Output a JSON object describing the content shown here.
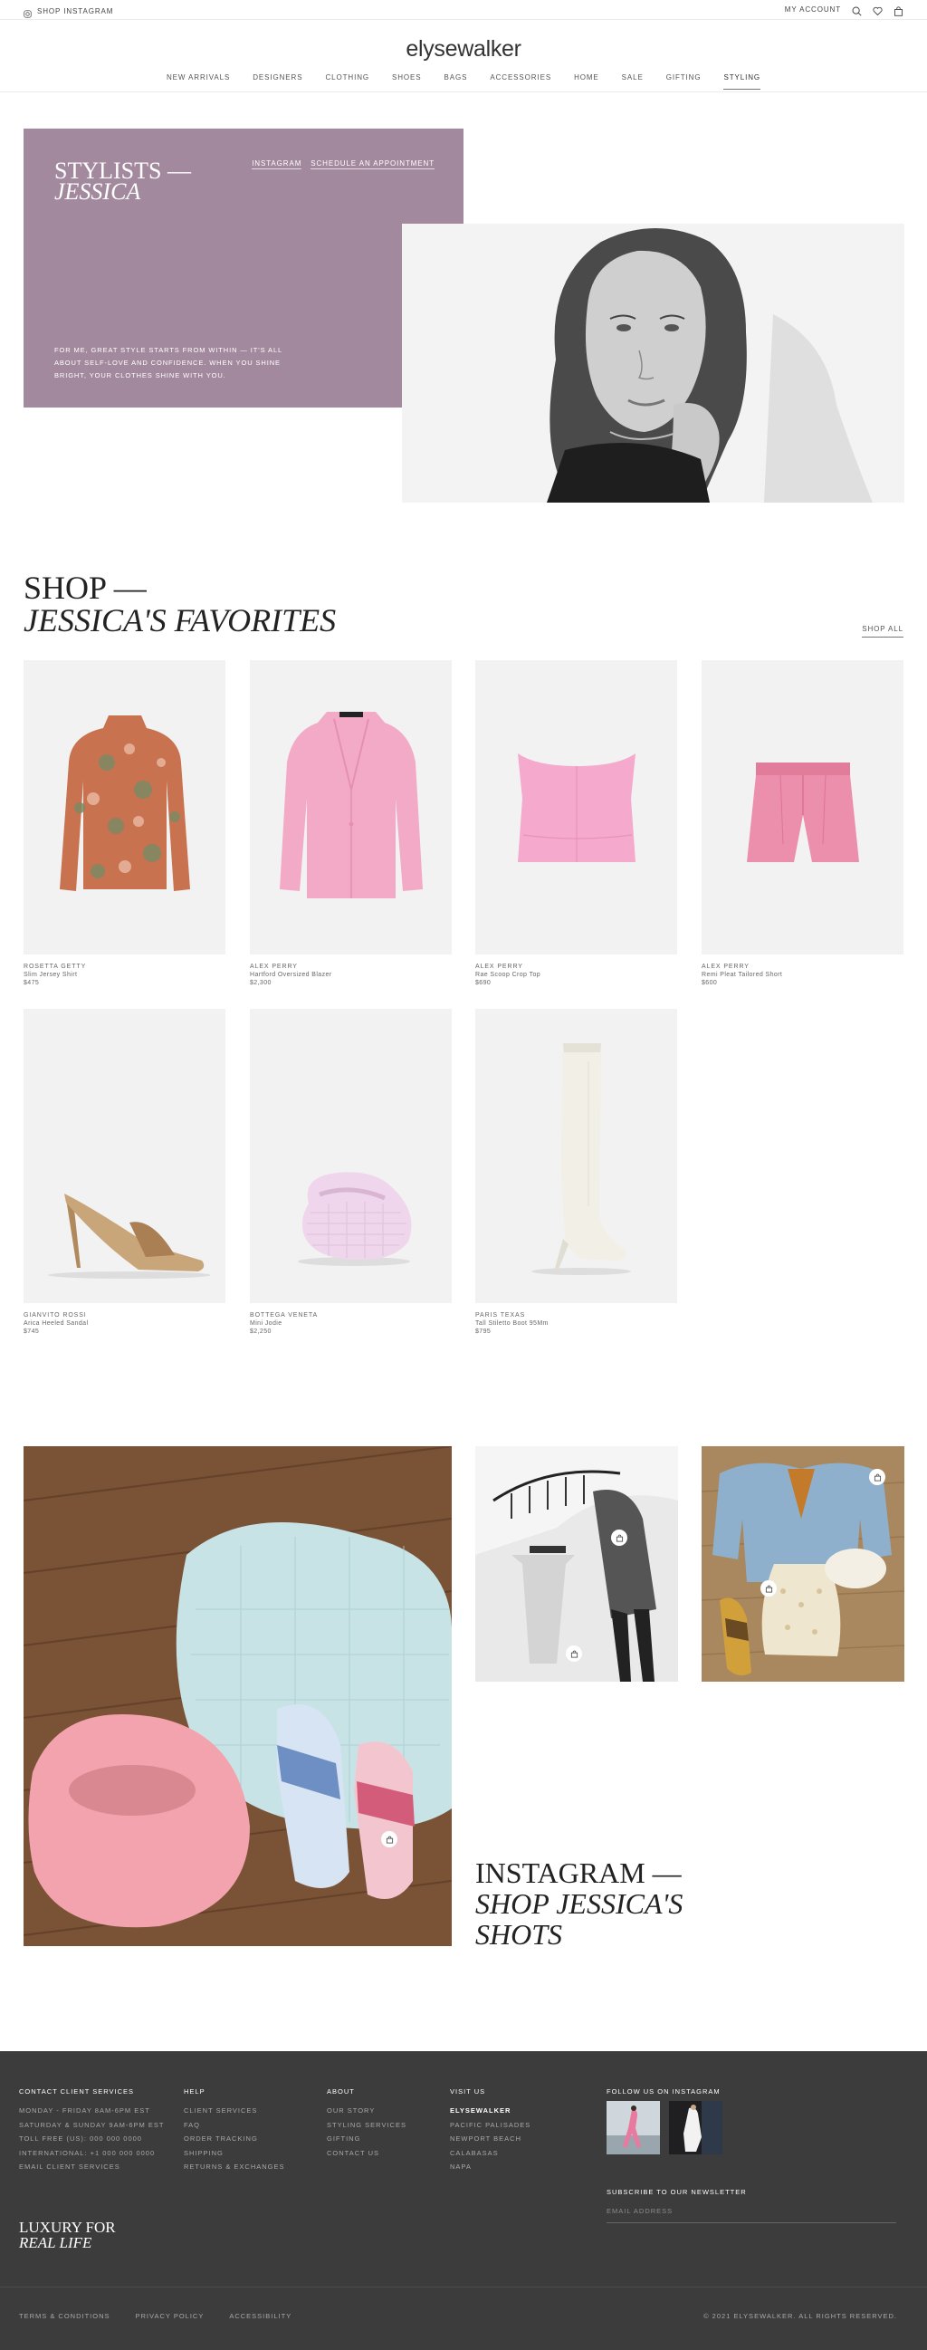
{
  "topbar": {
    "shop_instagram": "SHOP INSTAGRAM",
    "my_account": "MY ACCOUNT"
  },
  "header": {
    "logo": "elysewalker",
    "nav": [
      "NEW ARRIVALS",
      "DESIGNERS",
      "CLOTHING",
      "SHOES",
      "BAGS",
      "ACCESSORIES",
      "HOME",
      "SALE",
      "GIFTING",
      "STYLING"
    ],
    "active_nav": "STYLING"
  },
  "hero": {
    "title_line1": "STYLISTS —",
    "title_line2": "JESSICA",
    "link_instagram": "INSTAGRAM",
    "link_appointment": "SCHEDULE AN APPOINTMENT",
    "quote": "FOR ME, GREAT STYLE STARTS FROM WITHIN — IT'S ALL ABOUT SELF-LOVE AND CONFIDENCE. WHEN YOU SHINE BRIGHT, YOUR CLOTHES SHINE WITH YOU.",
    "bg_color": "#a3899d"
  },
  "favorites": {
    "title_line1": "SHOP —",
    "title_line2": "JESSICA'S FAVORITES",
    "shop_all": "SHOP ALL",
    "products": [
      {
        "brand": "ROSETTA GETTY",
        "name": "Slim Jersey Shirt",
        "price": "$475"
      },
      {
        "brand": "ALEX PERRY",
        "name": "Hartford Oversized Blazer",
        "price": "$2,300"
      },
      {
        "brand": "ALEX PERRY",
        "name": "Rae Scoop Crop Top",
        "price": "$690"
      },
      {
        "brand": "ALEX PERRY",
        "name": "Remi Pleat Tailored Short",
        "price": "$600"
      },
      {
        "brand": "GIANVITO ROSSI",
        "name": "Arica Heeled Sandal",
        "price": "$745"
      },
      {
        "brand": "BOTTEGA VENETA",
        "name": "Mini Jodie",
        "price": "$2,250"
      },
      {
        "brand": "PARIS TEXAS",
        "name": "Tall Stiletto Boot 95Mm",
        "price": "$795"
      }
    ]
  },
  "instagram": {
    "title_line1": "INSTAGRAM —",
    "title_line2": "SHOP JESSICA'S",
    "title_line3": "SHOTS"
  },
  "footer": {
    "contact": {
      "heading": "CONTACT CLIENT SERVICES",
      "items": [
        "MONDAY - FRIDAY 8AM-6PM EST",
        "SATURDAY & SUNDAY 9AM-6PM EST",
        "TOLL FREE (US): 000 000 0000",
        "INTERNATIONAL: +1 000 000 0000",
        "EMAIL CLIENT SERVICES"
      ]
    },
    "help": {
      "heading": "HELP",
      "items": [
        "CLIENT SERVICES",
        "FAQ",
        "ORDER TRACKING",
        "SHIPPING",
        "RETURNS & EXCHANGES"
      ]
    },
    "about": {
      "heading": "ABOUT",
      "items": [
        "OUR STORY",
        "STYLING SERVICES",
        "GIFTING",
        "CONTACT US"
      ]
    },
    "visit": {
      "heading": "VISIT US",
      "items": [
        "ELYSEWALKER",
        "PACIFIC PALISADES",
        "NEWPORT BEACH",
        "CALABASAS",
        "NAPA"
      ]
    },
    "follow_heading": "FOLLOW US ON INSTAGRAM",
    "newsletter_heading": "SUBSCRIBE TO OUR NEWSLETTER",
    "email_placeholder": "EMAIL ADDRESS",
    "tagline_line1": "LUXURY FOR",
    "tagline_line2": "REAL LIFE",
    "legal": [
      "TERMS & CONDITIONS",
      "PRIVACY POLICY",
      "ACCESSIBILITY"
    ],
    "copyright": "© 2021 ELYSEWALKER. ALL RIGHTS RESERVED."
  }
}
